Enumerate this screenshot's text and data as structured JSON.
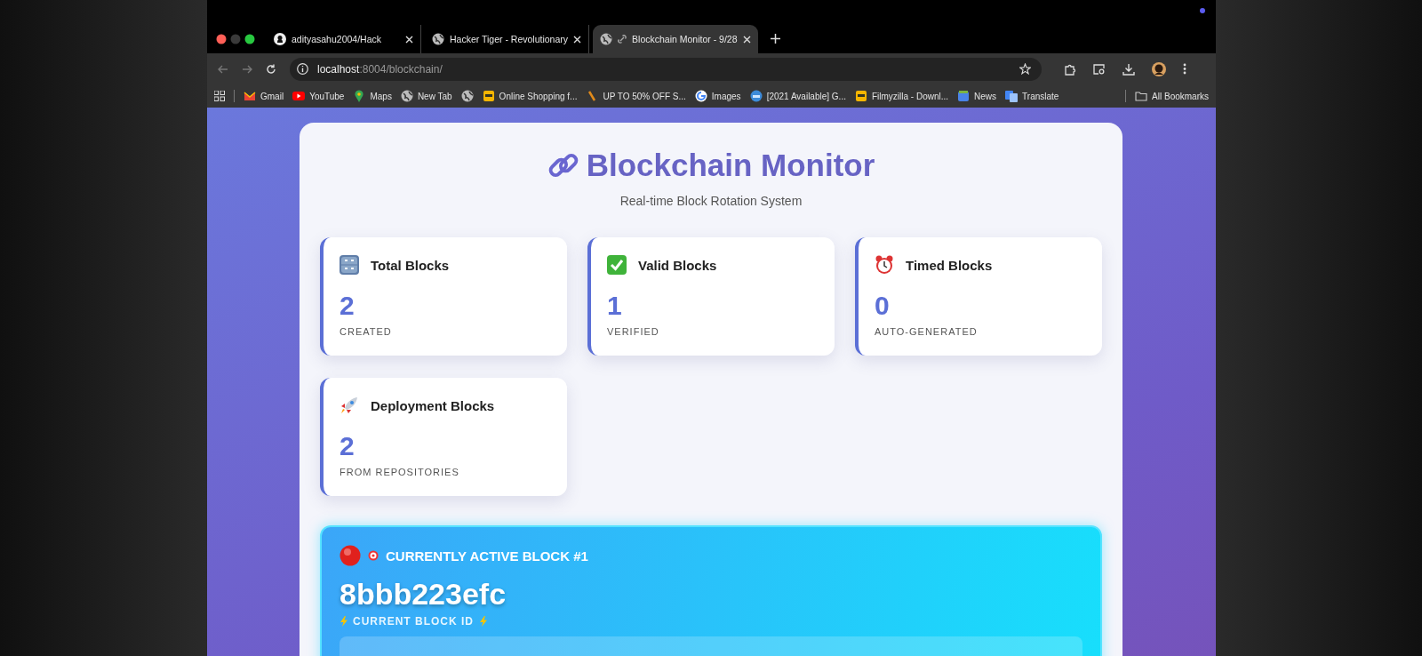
{
  "tabs": [
    {
      "title": "adityasahu2004/Hack",
      "kind": "github",
      "selected": false
    },
    {
      "title": "Hacker Tiger - Revolutionary",
      "kind": "globe",
      "selected": false
    },
    {
      "title": "Blockchain Monitor - 9/28",
      "kind": "globe",
      "selected": true
    }
  ],
  "address": {
    "host": "localhost",
    "path": ":8004/blockchain/"
  },
  "bookmarks": [
    {
      "label": "Gmail",
      "kind": "mail"
    },
    {
      "label": "YouTube",
      "kind": "play"
    },
    {
      "label": "Maps",
      "kind": "pin"
    },
    {
      "label": "New Tab",
      "kind": "globe"
    },
    {
      "kind": "globe"
    },
    {
      "label": "Online Shopping f...",
      "kind": "tile"
    },
    {
      "label": "UP TO 50% OFF S...",
      "kind": "stroke"
    },
    {
      "label": "Images",
      "kind": "gcircle"
    },
    {
      "label": "[2021 Available] G...",
      "kind": "badge"
    },
    {
      "label": "Filmyzilla - Downl...",
      "kind": "tile"
    },
    {
      "label": "News",
      "kind": "news"
    },
    {
      "label": "Translate",
      "kind": "translate"
    }
  ],
  "all_bookmarks": "All Bookmarks",
  "page": {
    "title": "Blockchain Monitor",
    "subtitle": "Real-time Block Rotation System",
    "stats": [
      {
        "kind": "keypad",
        "label": "Total Blocks",
        "value": "2",
        "caption": "CREATED"
      },
      {
        "kind": "check",
        "label": "Valid Blocks",
        "value": "1",
        "caption": "VERIFIED"
      },
      {
        "kind": "clock",
        "label": "Timed Blocks",
        "value": "0",
        "caption": "AUTO-GENERATED"
      },
      {
        "kind": "rocket",
        "label": "Deployment Blocks",
        "value": "2",
        "caption": "FROM REPOSITORIES"
      }
    ],
    "active_block": {
      "heading": "CURRENTLY ACTIVE BLOCK #1",
      "id": "8bbb223efc",
      "caption": "CURRENT BLOCK ID"
    }
  }
}
